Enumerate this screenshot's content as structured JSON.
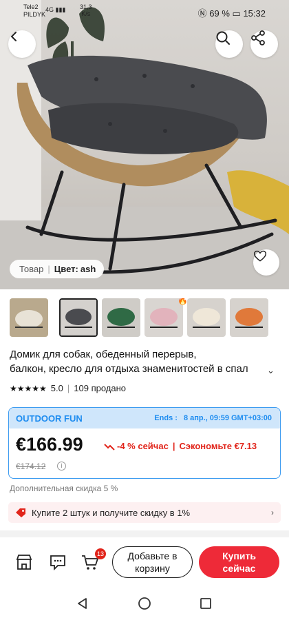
{
  "status_bar": {
    "carrier": "Tele2",
    "carrier_sub": "PILDYK",
    "network": "4G",
    "speed_value": "31,3",
    "speed_unit": "K/s",
    "battery": "69 %",
    "time": "15:32"
  },
  "hero": {
    "variant_label": "Товар",
    "color_label": "Цвет:",
    "color_value": "ash"
  },
  "thumbnails": [
    {
      "name": "beige-chair",
      "selected": false
    },
    {
      "name": "gray-chair",
      "selected": true
    },
    {
      "name": "green-chair",
      "selected": false
    },
    {
      "name": "pink-chair",
      "selected": false,
      "hot": true
    },
    {
      "name": "cream-chair",
      "selected": false
    },
    {
      "name": "orange-chair",
      "selected": false
    }
  ],
  "product": {
    "title_line1": "Домик для собак, обеденный перерыв,",
    "title_line2": "балкон, кресло для отдыха знаменитостей в спал",
    "rating": "5.0",
    "sold": "109 продано"
  },
  "deal": {
    "brand": "OUTDOOR FUN",
    "ends_label": "Ends :",
    "ends_value": "8 апр., 09:59 GMT+03:00",
    "price": "€166.99",
    "discount": "-4 % сейчас",
    "save_text": "Сэкономьте €7.13",
    "old_price": "€174.12"
  },
  "extra_discount": "Дополнительная скидка 5 %",
  "promo": "Купите 2 штук и получите скидку в 1%",
  "bottom_bar": {
    "cart_count": "13",
    "add_to_cart_line1": "Добавьте в",
    "add_to_cart_line2": "корзину",
    "buy_line1": "Купить",
    "buy_line2": "сейчас"
  },
  "colors": {
    "accent_red": "#ee2a38",
    "deal_blue": "#1d8cf0"
  }
}
